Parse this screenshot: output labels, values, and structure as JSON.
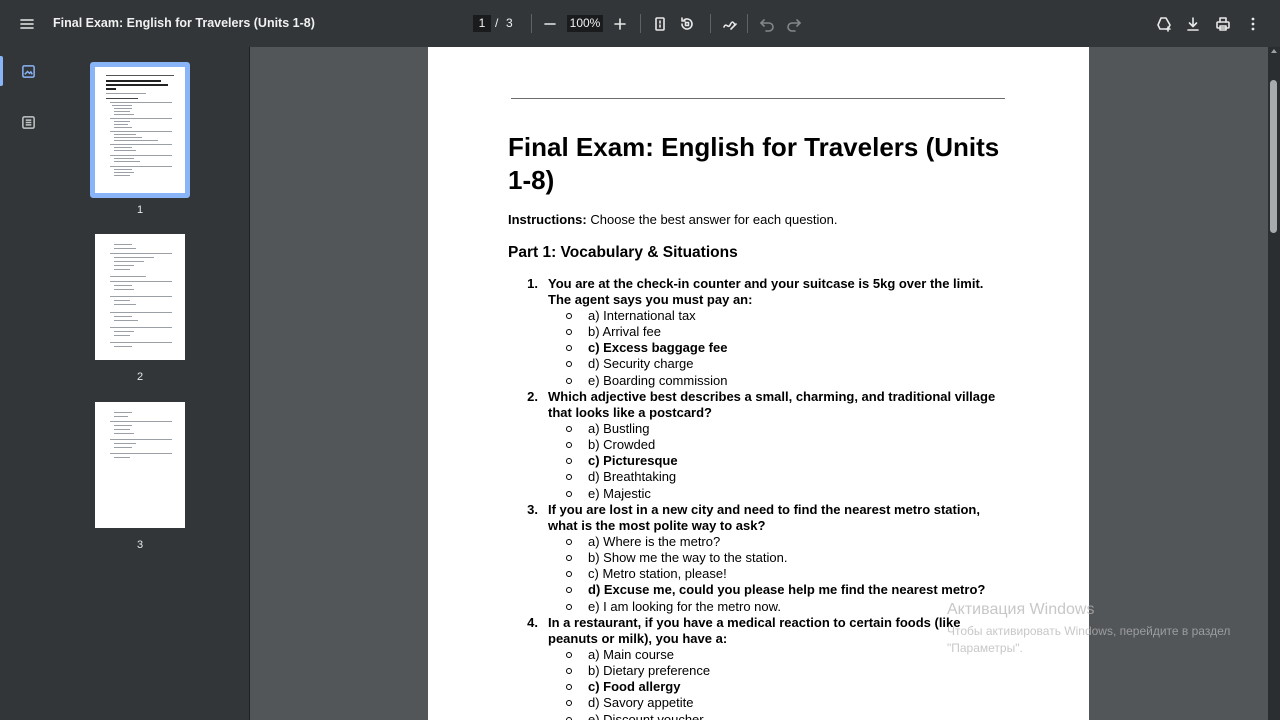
{
  "toolbar": {
    "title": "Final Exam: English for Travelers (Units 1-8)",
    "current_page": "1",
    "page_separator": "/",
    "total_pages": "3",
    "zoom": "100%"
  },
  "sidebar": {
    "thumbnails": [
      {
        "label": "1",
        "selected": true
      },
      {
        "label": "2",
        "selected": false
      },
      {
        "label": "3",
        "selected": false
      }
    ]
  },
  "document": {
    "title": "Final Exam: English for Travelers (Units 1-8)",
    "instructions_label": "Instructions:",
    "instructions_text": " Choose the best answer for each question.",
    "part1_heading": "Part 1: Vocabulary & Situations",
    "questions": [
      {
        "number": "1.",
        "text": "You are at the check-in counter and your suitcase is 5kg over the limit. The agent says you must pay an:",
        "options": [
          "a) International tax",
          "b) Arrival fee",
          "c) Excess baggage fee",
          "d) Security charge",
          "e) Boarding commission"
        ],
        "bold_option": 2
      },
      {
        "number": "2.",
        "text": "Which adjective best describes a small, charming, and traditional village that looks like a postcard?",
        "options": [
          "a) Bustling",
          "b) Crowded",
          "c) Picturesque",
          "d) Breathtaking",
          "e) Majestic"
        ],
        "bold_option": 2
      },
      {
        "number": "3.",
        "text": "If you are lost in a new city and need to find the nearest metro station, what is the most polite way to ask?",
        "options": [
          "a) Where is the metro?",
          "b) Show me the way to the station.",
          "c) Metro station, please!",
          "d) Excuse me, could you please help me find the nearest metro?",
          "e) I am looking for the metro now."
        ],
        "bold_option": 3
      },
      {
        "number": "4.",
        "text": "In a restaurant, if you have a medical reaction to certain foods (like peanuts or milk), you have a:",
        "options": [
          "a) Main course",
          "b) Dietary preference",
          "c) Food allergy",
          "d) Savory appetite",
          "e) Discount voucher"
        ],
        "bold_option": 2
      }
    ]
  },
  "watermark": {
    "title": "Активация Windows",
    "line1": "Чтобы активировать Windows, перейдите в раздел",
    "line2": "\"Параметры\"."
  },
  "icons": {
    "menu": "menu-icon",
    "fit": "fit-page-icon",
    "rotate": "rotate-icon",
    "annotate": "annotate-pen-icon",
    "undo": "undo-icon",
    "redo": "redo-icon",
    "drive": "add-to-drive-icon",
    "download": "download-icon",
    "print": "print-icon",
    "more": "more-vert-icon",
    "thumbnails": "thumbnail-view-icon",
    "outline": "outline-view-icon"
  },
  "colors": {
    "toolbar_bg": "#323639",
    "viewer_bg": "#525659",
    "accent": "#8ab4f8"
  }
}
